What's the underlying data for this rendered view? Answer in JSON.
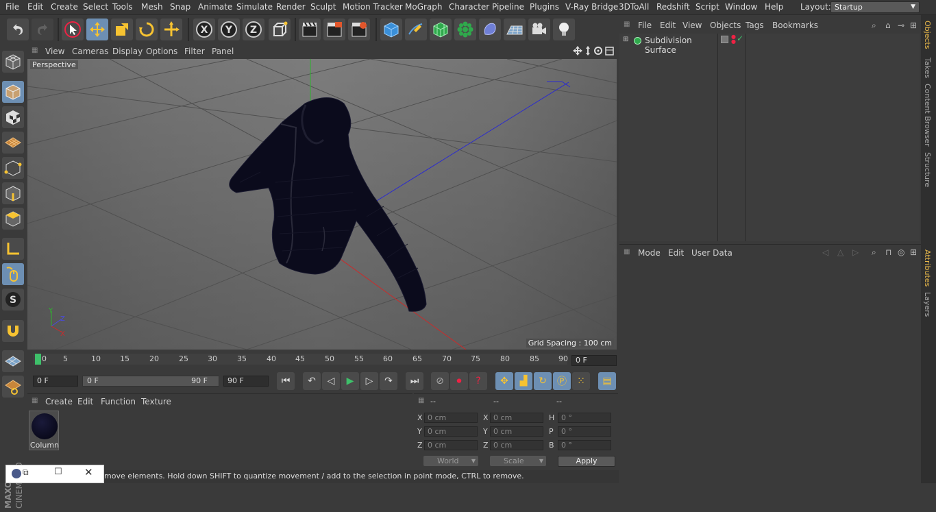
{
  "menubar": {
    "items": [
      "File",
      "Edit",
      "Create",
      "Select",
      "Tools",
      "Mesh",
      "Snap",
      "Animate",
      "Simulate",
      "Render",
      "Sculpt",
      "Motion Tracker",
      "MoGraph",
      "Character",
      "Pipeline",
      "Plugins",
      "V-Ray Bridge",
      "3DToAll",
      "Redshift",
      "Script",
      "Window",
      "Help"
    ],
    "layout_label": "Layout:",
    "layout_value": "Startup"
  },
  "toolbar": {
    "icons": [
      "undo-icon",
      "redo-icon",
      "live-selection-icon",
      "move-icon",
      "scale-icon",
      "rotate-icon",
      "transform-icon",
      "x-axis-icon",
      "y-axis-icon",
      "z-axis-icon",
      "coordinate-system-icon",
      "render-view-icon",
      "render-picture-viewer-icon",
      "render-settings-icon",
      "cube-icon",
      "pen-spline-icon",
      "subdivision-icon",
      "cloner-icon",
      "deformer-icon",
      "floor-icon",
      "camera-icon",
      "light-icon"
    ]
  },
  "viewport": {
    "menu": [
      "View",
      "Cameras",
      "Display",
      "Options",
      "Filter",
      "Panel"
    ],
    "label": "Perspective",
    "grid_spacing": "Grid Spacing : 100 cm"
  },
  "timeline": {
    "ticks": [
      "0",
      "5",
      "10",
      "15",
      "20",
      "25",
      "30",
      "35",
      "40",
      "45",
      "50",
      "55",
      "60",
      "65",
      "70",
      "75",
      "80",
      "85",
      "90"
    ],
    "current_frame": "0 F",
    "start_field": "0 F",
    "range_start": "0 F",
    "range_end": "90 F",
    "end_field": "90 F"
  },
  "material_manager": {
    "menu": [
      "Create",
      "Edit",
      "Function",
      "Texture"
    ],
    "material_name": "Column"
  },
  "coordinates": {
    "headers": [
      "--",
      "--",
      "--"
    ],
    "rows": [
      {
        "a": "X",
        "av": "0 cm",
        "b": "X",
        "bv": "0 cm",
        "c": "H",
        "cv": "0 °"
      },
      {
        "a": "Y",
        "av": "0 cm",
        "b": "Y",
        "bv": "0 cm",
        "c": "P",
        "cv": "0 °"
      },
      {
        "a": "Z",
        "av": "0 cm",
        "b": "Z",
        "bv": "0 cm",
        "c": "B",
        "cv": "0 °"
      }
    ],
    "world": "World",
    "scale": "Scale",
    "apply": "Apply"
  },
  "object_manager": {
    "menu": [
      "File",
      "Edit",
      "View",
      "Objects",
      "Tags",
      "Bookmarks"
    ],
    "object_name": "Subdivision Surface"
  },
  "attribute_manager": {
    "menu": [
      "Mode",
      "Edit",
      "User Data"
    ]
  },
  "side_tabs": [
    "Objects",
    "Takes",
    "Content Browser",
    "Structure",
    "Attributes",
    "Layers"
  ],
  "status": {
    "text": "move elements. Hold down SHIFT to quantize movement / add to the selection in point mode, CTRL to remove."
  },
  "branding": {
    "line1": "MAXON",
    "line2": "CINEMA 4D"
  },
  "colors": {
    "accent": "#6d8fb3",
    "tab_active": "#e8b84a",
    "jacket": "#0b0b1c"
  }
}
